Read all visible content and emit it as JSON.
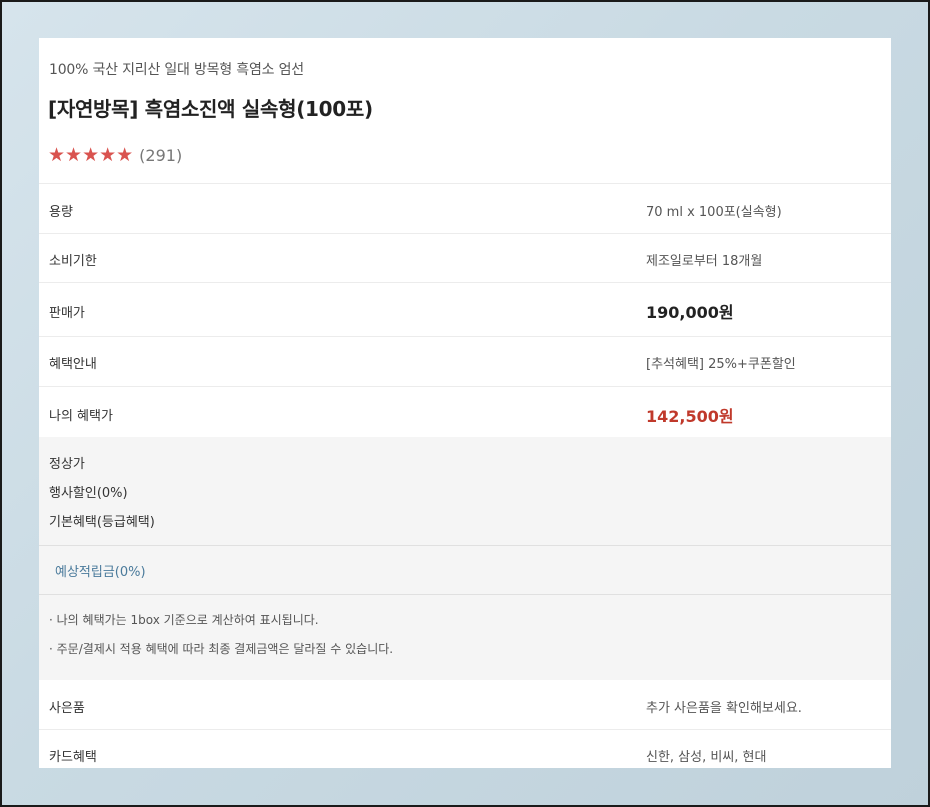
{
  "product": {
    "subtitle": "100% 국산 지리산 일대 방목형 흑염소 엄선",
    "title": "[자연방목] 흑염소진액 실속형(100포)",
    "stars": "★★★★★",
    "rating_value": 5,
    "rating_count": "(291)"
  },
  "specs": [
    {
      "label": "용량",
      "value": "70 ml x 100포(실속형)"
    },
    {
      "label": "소비기한",
      "value": "제조일로부터 18개월"
    },
    {
      "label": "판매가",
      "value": "190,000원"
    },
    {
      "label": "혜택안내",
      "value": "[추석혜택] 25%+쿠폰할인"
    },
    {
      "label": "나의 혜택가",
      "value": "142,500원"
    }
  ],
  "breakdown": {
    "lines": [
      "정상가",
      "행사할인(0%)",
      "기본혜택(등급혜택)"
    ],
    "points": "예상적립금(0%)",
    "notes": [
      "· 나의 혜택가는 1box 기준으로 계산하여 표시됩니다.",
      "· 주문/결제시 적용 혜택에 따라 최종 결제금액은 달라질 수 있습니다."
    ]
  },
  "extra": [
    {
      "label": "사은품",
      "value": "추가 사은품을 확인해보세요."
    },
    {
      "label": "카드혜택",
      "value": "신한, 삼성, 비씨, 현대"
    }
  ],
  "colors": {
    "star": "#d9534f",
    "benefit_price": "#c0392b",
    "points_link": "#4a7a9b"
  }
}
